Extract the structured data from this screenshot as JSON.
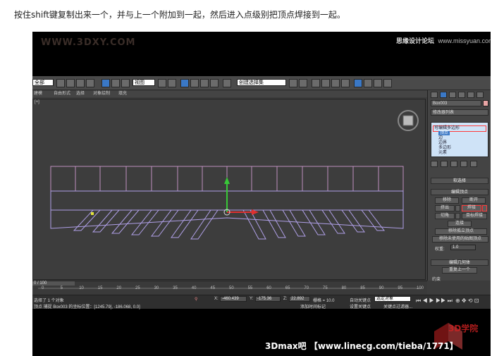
{
  "caption": "按住shift键复制出来一个，并与上一个附加到一起，然后进入点级别把顶点焊接到一起。",
  "watermark_left": "WWW.3DXY.COM",
  "brand_right": {
    "name": "思缘设计论坛",
    "url": "www.missyuan.com"
  },
  "toolbar": {
    "selection_filter": "全部",
    "ref_coord": "视图",
    "named_selection": "创建选择集"
  },
  "ribbon": {
    "tabs": [
      "建模",
      "自由形式",
      "选择",
      "对象绘制",
      "填充"
    ]
  },
  "viewport": {
    "label": "[+]"
  },
  "command_panel": {
    "object_name": "Box003",
    "modifier_list": "修改器列表",
    "stack": {
      "root": "可编辑多边形",
      "items": [
        "顶点",
        "边",
        "边界",
        "多边形",
        "元素"
      ],
      "selected": "顶点"
    },
    "soft_selection": "软选择",
    "edit_vertices": "编辑顶点",
    "buttons": {
      "remove": "移除",
      "break": "断开",
      "extrude": "挤出",
      "weld": "焊接",
      "chamfer": "切角",
      "target_weld": "目标焊接",
      "connect": "连接",
      "remove_isolated": "移除孤立顶点",
      "remove_unused_map": "移除未使用的贴图顶点"
    },
    "weight_label": "权重:",
    "weight_value": "1.0",
    "edit_geometry": "编辑几何体",
    "repeat_last": "重复上一个",
    "constraints": "约束"
  },
  "timeline": {
    "frame_counter": "0 / 100",
    "ticks": [
      "0",
      "5",
      "10",
      "15",
      "20",
      "25",
      "30",
      "35",
      "40",
      "45",
      "50",
      "55",
      "60",
      "65",
      "70",
      "75",
      "80",
      "85",
      "90",
      "95",
      "100"
    ]
  },
  "status": {
    "selected": "选择了 1 个对象",
    "prompt": "顶点 捕捉 Box003 的坐标位置：[1245.79], -186.068, 0.0]",
    "x_label": "X:",
    "x": "-460.439",
    "y_label": "Y:",
    "y": "-175.36",
    "z_label": "Z:",
    "z": "22.892",
    "grid": "栅格 = 10.0",
    "add_time_tag": "添加时间标记",
    "auto_key": "自动关键点",
    "set_key": "设置关键点",
    "selected_object": "选定对象",
    "key_filters": "关键点过滤器..."
  },
  "footer": "3Dmax吧 【www.linecg.com/tieba/1771】",
  "footer_logo": "3D学院",
  "colors": {
    "viewport_bg": "#3d3d3d",
    "object_edge": "#b0a0e8",
    "selection_red": "#ff3b3b",
    "gizmo_green": "#38c838",
    "gizmo_red": "#e03030",
    "active_blue": "#3a78c6"
  }
}
